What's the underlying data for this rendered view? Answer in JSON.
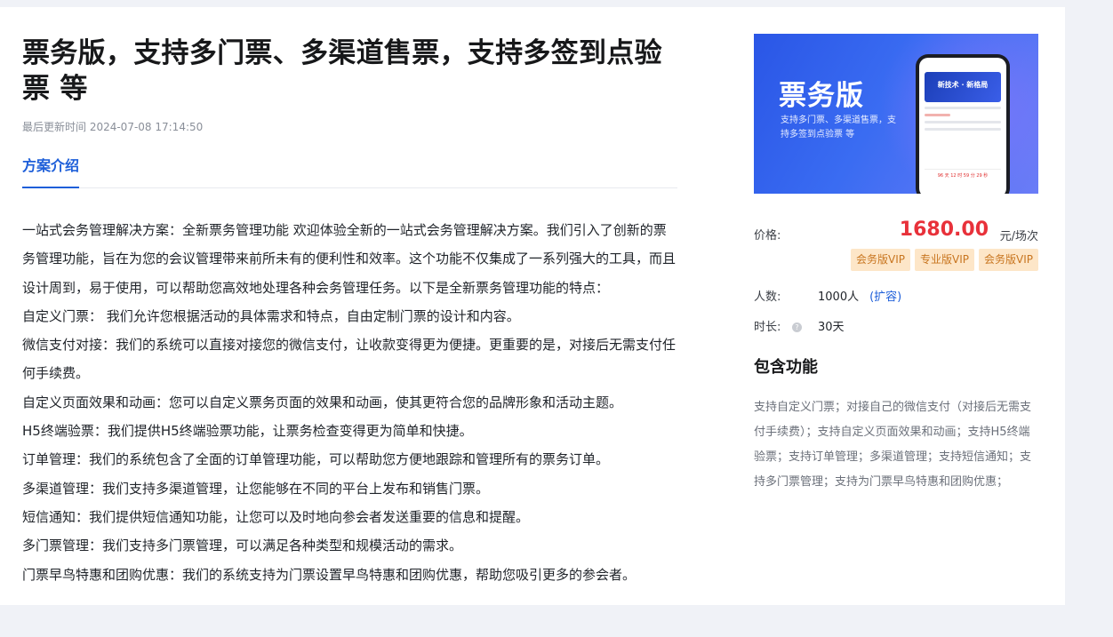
{
  "title": "票务版，支持多门票、多渠道售票，支持多签到点验票 等",
  "updated": "最后更新时间 2024-07-08 17:14:50",
  "tab": "方案介绍",
  "description": [
    "一站式会务管理解决方案：全新票务管理功能 欢迎体验全新的一站式会务管理解决方案。我们引入了创新的票务管理功能，旨在为您的会议管理带来前所未有的便利性和效率。这个功能不仅集成了一系列强大的工具，而且设计周到，易于使用，可以帮助您高效地处理各种会务管理任务。以下是全新票务管理功能的特点：",
    "自定义门票： 我们允许您根据活动的具体需求和特点，自由定制门票的设计和内容。",
    "微信支付对接：我们的系统可以直接对接您的微信支付，让收款变得更为便捷。更重要的是，对接后无需支付任何手续费。",
    "自定义页面效果和动画：您可以自定义票务页面的效果和动画，使其更符合您的品牌形象和活动主题。",
    "H5终端验票：我们提供H5终端验票功能，让票务检查变得更为简单和快捷。",
    "订单管理：我们的系统包含了全面的订单管理功能，可以帮助您方便地跟踪和管理所有的票务订单。",
    "多渠道管理：我们支持多渠道管理，让您能够在不同的平台上发布和销售门票。",
    "短信通知：我们提供短信通知功能，让您可以及时地向参会者发送重要的信息和提醒。",
    "多门票管理：我们支持多门票管理，可以满足各种类型和规模活动的需求。",
    "门票早鸟特惠和团购优惠：我们的系统支持为门票设置早鸟特惠和团购优惠，帮助您吸引更多的参会者。"
  ],
  "banner": {
    "title": "票务版",
    "subtitle": "支持多门票、多渠道售票，支持多签到点验票 等",
    "phone_hero": "新技术 · 新格局",
    "phone_countdown": "96 天 12 时 59 分 29 秒"
  },
  "price": {
    "label": "价格:",
    "value": "1680.00",
    "unit": "元/场次"
  },
  "tags": [
    "会务版VIP",
    "专业版VIP",
    "会务版VIP"
  ],
  "people": {
    "label": "人数:",
    "value": "1000人",
    "expand": "(扩容)"
  },
  "duration": {
    "label": "时长:",
    "value": "30天"
  },
  "features_title": "包含功能",
  "features": "支持自定义门票；对接自己的微信支付（对接后无需支付手续费）；支持自定义页面效果和动画；支持H5终端验票；支持订单管理；多渠道管理；支持短信通知；支持多门票管理；支持为门票早鸟特惠和团购优惠；",
  "colors": {
    "accent": "#1e5fd9",
    "price": "#e8313a",
    "tag_bg": "#fde6c8",
    "tag_text": "#c8751f"
  }
}
